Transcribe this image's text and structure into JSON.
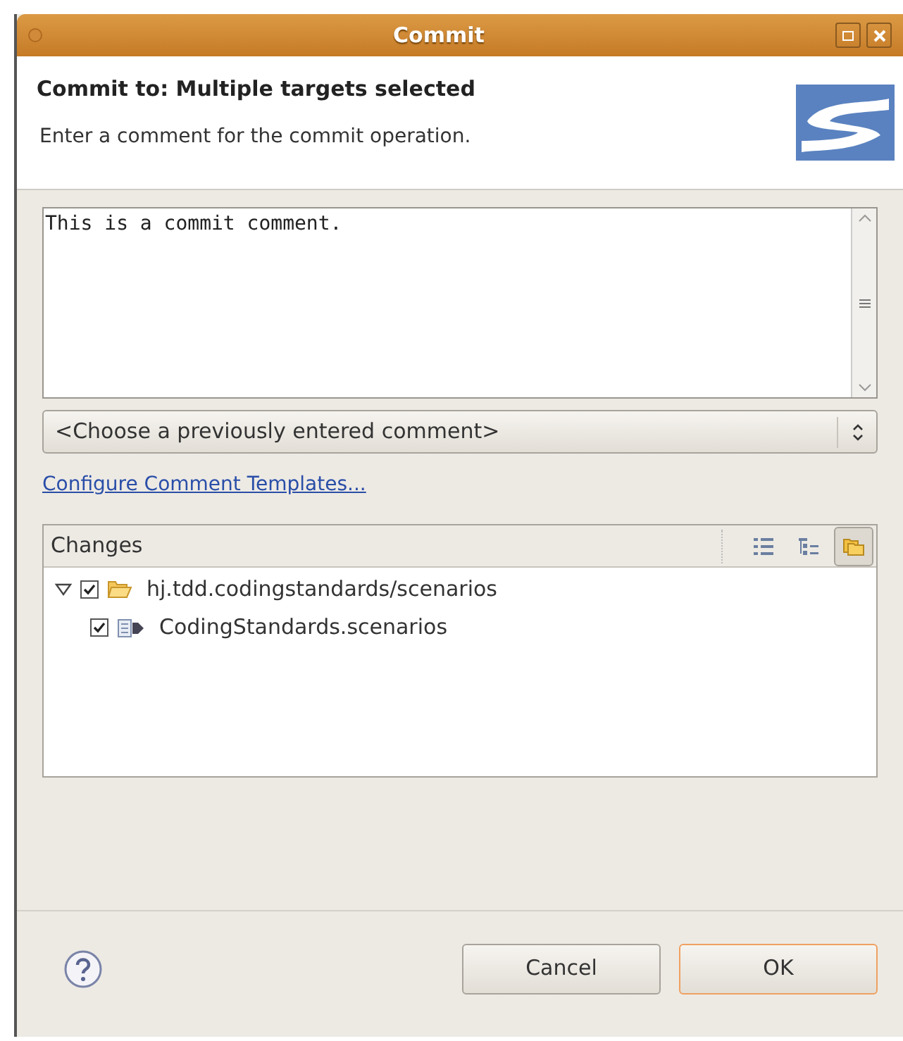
{
  "window": {
    "title": "Commit"
  },
  "header": {
    "title": "Commit to: Multiple targets selected",
    "message": "Enter a comment for the commit operation."
  },
  "comment": {
    "value": "This is a commit comment."
  },
  "history_combo": {
    "value": "<Choose a previously entered comment>"
  },
  "templates_link": "Configure Comment Templates...",
  "changes": {
    "title": "Changes",
    "toolbar": [
      {
        "kind": "flat",
        "selected": false
      },
      {
        "kind": "tree",
        "selected": false
      },
      {
        "kind": "folders",
        "selected": true
      }
    ],
    "tree": [
      {
        "label": "hj.tdd.codingstandards/scenarios",
        "kind": "folder",
        "checked": true,
        "expanded": true,
        "children": [
          {
            "label": "CodingStandards.scenarios",
            "kind": "file",
            "checked": true
          }
        ]
      }
    ]
  },
  "buttons": [
    {
      "label": "Cancel",
      "default": false
    },
    {
      "label": "OK",
      "default": true
    }
  ]
}
